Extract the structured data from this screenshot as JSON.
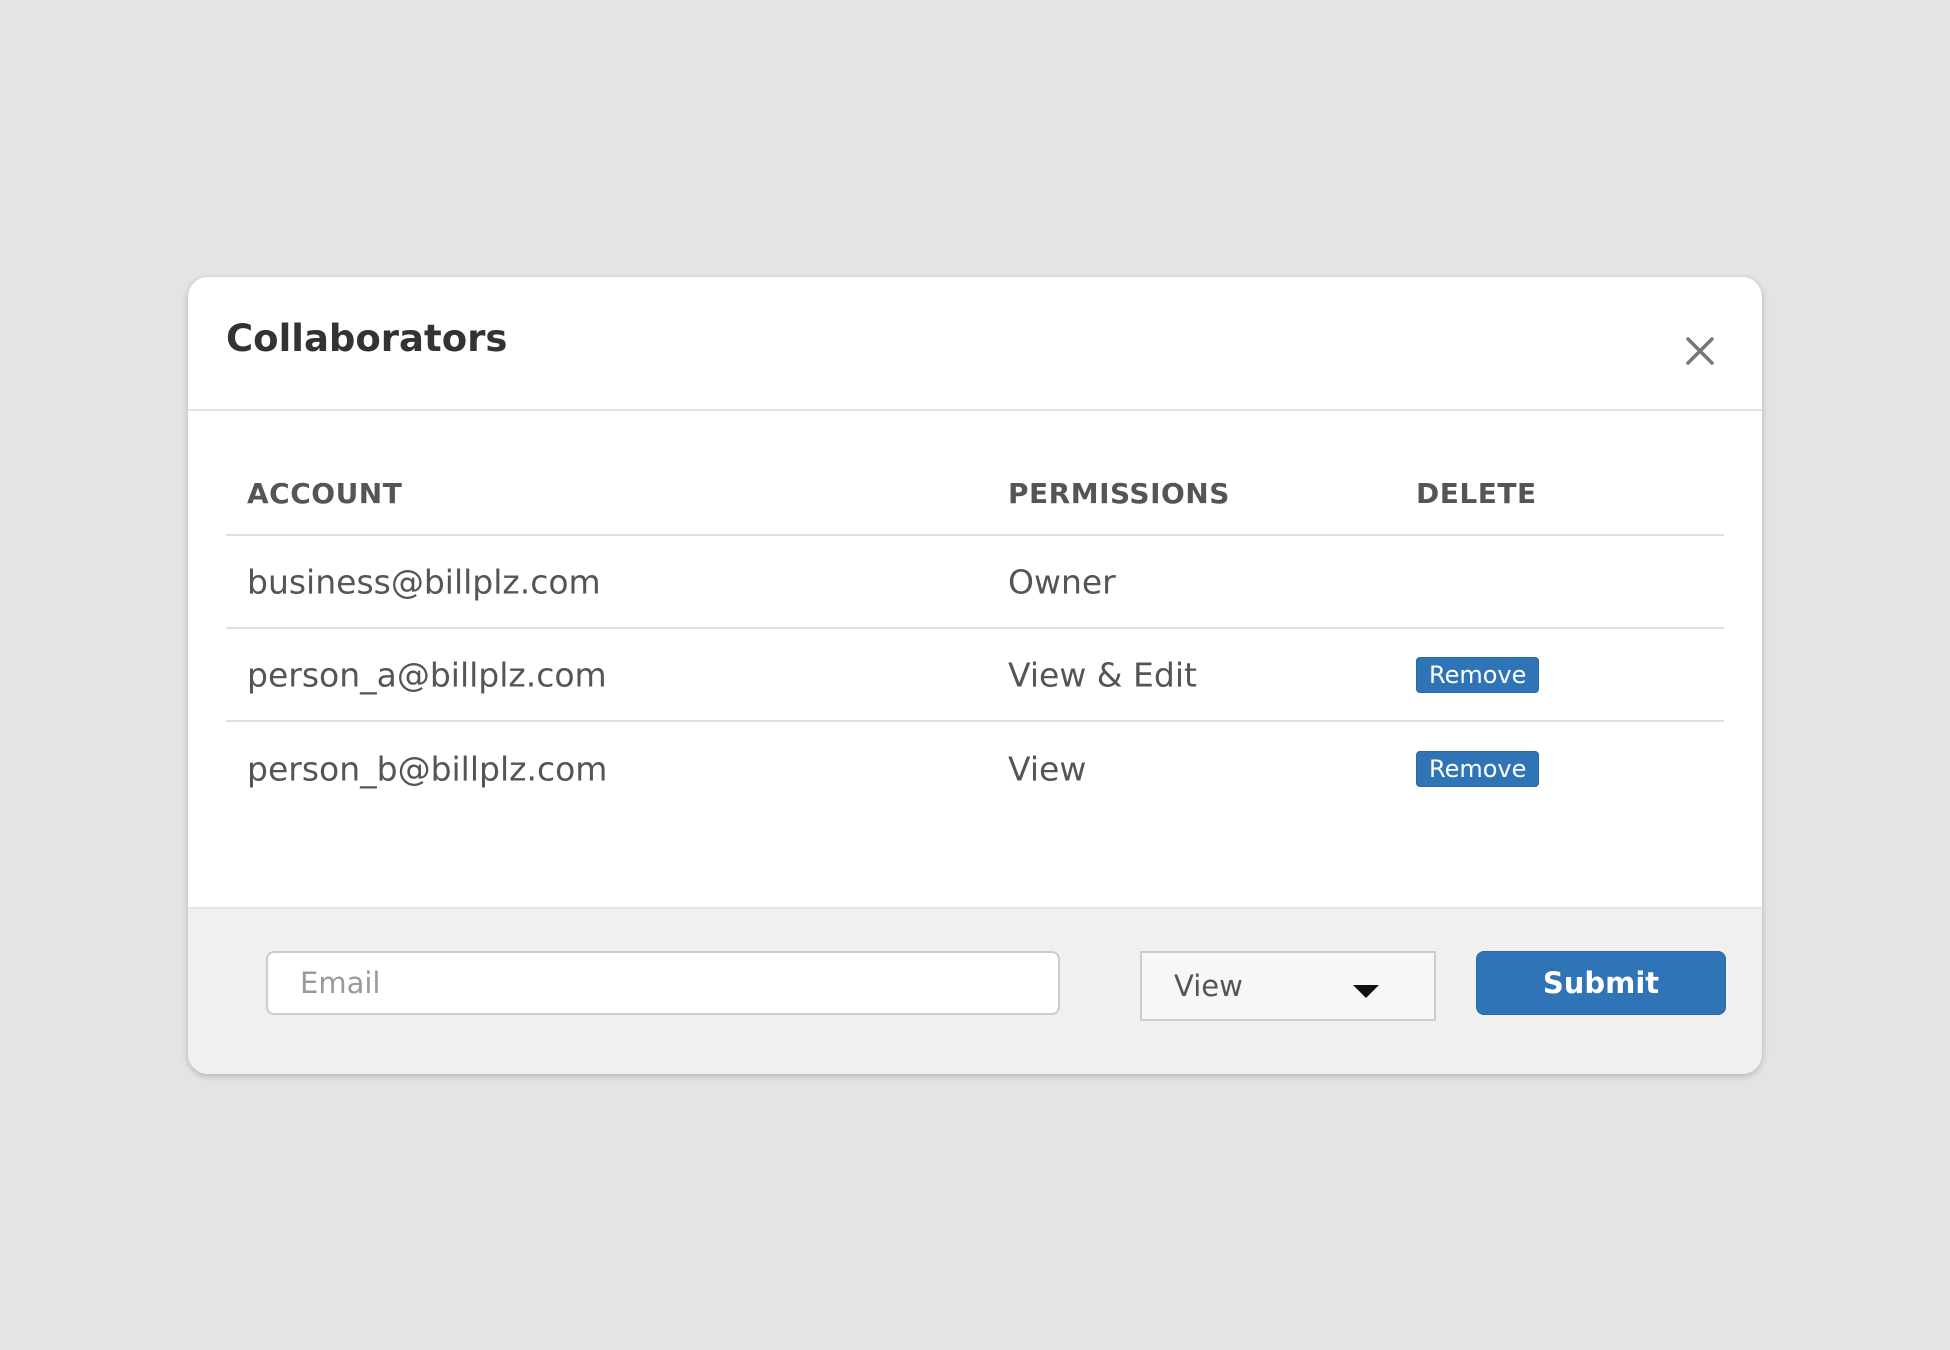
{
  "modal": {
    "title": "Collaborators",
    "close_icon": "close-icon"
  },
  "table": {
    "headers": [
      "ACCOUNT",
      "PERMISSIONS",
      "DELETE"
    ],
    "rows": [
      {
        "account": "business@billplz.com",
        "permission": "Owner",
        "delete_label": ""
      },
      {
        "account": "person_a@billplz.com",
        "permission": "View & Edit",
        "delete_label": "Remove"
      },
      {
        "account": "person_b@billplz.com",
        "permission": "View",
        "delete_label": "Remove"
      }
    ]
  },
  "footer": {
    "email_placeholder": "Email",
    "email_value": "",
    "permission_selected": "View",
    "dropdown_icon": "caret-down-icon",
    "submit_label": "Submit"
  },
  "colors": {
    "background": "#e4e4e4",
    "accent": "#2f74b6",
    "text": "#555555",
    "title": "#333333"
  }
}
